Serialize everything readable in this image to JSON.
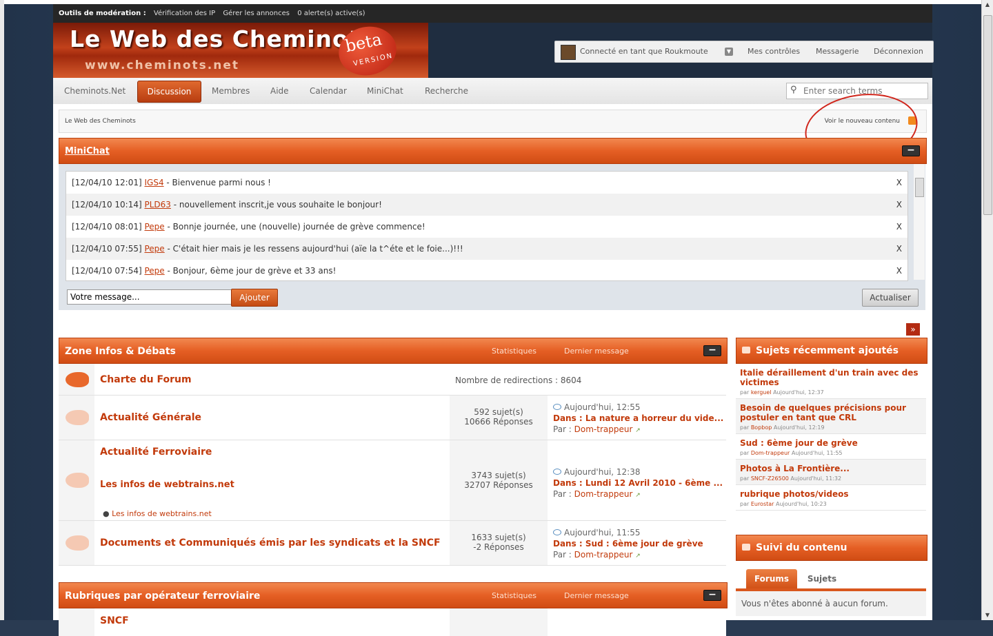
{
  "modbar": {
    "label": "Outils de modération :",
    "links": [
      "Vérification des IP",
      "Gérer les annonces",
      "0 alerte(s) active(s)"
    ]
  },
  "logo": {
    "title": "Le Web des Cheminots",
    "url": "www.cheminots.net",
    "beta": "beta",
    "version": "VERSION"
  },
  "userbar": {
    "connected": "Connecté en tant que Roukmoute",
    "links": [
      "Mes contrôles",
      "Messagerie",
      "Déconnexion"
    ]
  },
  "nav": {
    "items": [
      "Cheminots.Net",
      "Discussion",
      "Membres",
      "Aide",
      "Calendar",
      "MiniChat",
      "Recherche"
    ],
    "active": "Discussion",
    "search_placeholder": "Enter search terms"
  },
  "breadcrumb": {
    "home": "Le Web des Cheminots",
    "new_content": "Voir le nouveau contenu"
  },
  "minichat": {
    "title": "MiniChat",
    "messages": [
      {
        "time": "[12/04/10 12:01]",
        "user": "IGS4",
        "text": " - Bienvenue parmi nous !"
      },
      {
        "time": "[12/04/10 10:14]",
        "user": "PLD63",
        "text": " - nouvellement inscrit,je vous souhaite le bonjour!"
      },
      {
        "time": "[12/04/10 08:01]",
        "user": "Pepe",
        "text": " - Bonnje journée, une (nouvelle) journée de grève commence!"
      },
      {
        "time": "[12/04/10 07:55]",
        "user": "Pepe",
        "text": " - C'était hier mais je les ressens aujourd'hui (aïe la t^éte et le foie...)!!!"
      },
      {
        "time": "[12/04/10 07:54]",
        "user": "Pepe",
        "text": " - Bonjour, 6ème jour de grève et 33 ans!"
      }
    ],
    "delete": "X",
    "input_value": "Votre message...",
    "add_button": "Ajouter",
    "refresh_button": "Actualiser"
  },
  "categories": [
    {
      "title": "Zone Infos & Débats",
      "stats": "Statistiques",
      "last": "Dernier message"
    },
    {
      "title": "Rubriques par opérateur ferroviaire",
      "stats": "Statistiques",
      "last": "Dernier message"
    }
  ],
  "forums": {
    "charte": {
      "name": "Charte du Forum",
      "redirects": "Nombre de redirections : 8604"
    },
    "actu": {
      "name": "Actualité Générale",
      "topics": "592 sujet(s)",
      "replies": "10666 Réponses",
      "when": "Aujourd'hui, 12:55",
      "in": "Dans : ",
      "topic": "La nature a horreur du vide...",
      "by_label": "Par : ",
      "by": "Dom-trappeur"
    },
    "ferro": {
      "name": "Actualité Ferroviaire",
      "subname": "Les infos de webtrains.net",
      "sublink": "Les infos de webtrains.net",
      "topics": "3743 sujet(s)",
      "replies": "32707 Réponses",
      "when": "Aujourd'hui, 12:38",
      "in": "Dans : ",
      "topic": "Lundi 12 Avril 2010 - 6ème ...",
      "by_label": "Par : ",
      "by": "Dom-trappeur"
    },
    "docs": {
      "name": "Documents et Communiqués émis par les syndicats et la SNCF",
      "topics": "1633 sujet(s)",
      "replies": "-2 Réponses",
      "when": "Aujourd'hui, 11:55",
      "in": "Dans : ",
      "topic": "Sud : 6ème jour de grève",
      "by_label": "Par : ",
      "by": "Dom-trappeur"
    },
    "sncf": {
      "name": "SNCF"
    }
  },
  "recent": {
    "title": "Sujets récemment ajoutés",
    "items": [
      {
        "title": "Italie déraillement d'un train avec des victimes",
        "by": "par ",
        "user": "kerguel",
        "when": " Aujourd'hui, 12:37"
      },
      {
        "title": "Besoin de quelques précisions pour postuler en tant que CRL",
        "by": "par ",
        "user": "Bopbop",
        "when": " Aujourd'hui, 12:19"
      },
      {
        "title": "Sud : 6ème jour de grève",
        "by": "par ",
        "user": "Dom-trappeur",
        "when": " Aujourd'hui, 11:55"
      },
      {
        "title": "Photos à La Frontière...",
        "by": "par ",
        "user": "SNCF-Z26500",
        "when": " Aujourd'hui, 11:32"
      },
      {
        "title": "rubrique photos/videos",
        "by": "par ",
        "user": "Eurostar",
        "when": " Aujourd'hui, 10:23"
      }
    ]
  },
  "follow": {
    "title": "Suivi du contenu",
    "tab_forums": "Forums",
    "tab_topics": "Sujets",
    "message": "Vous n'êtes abonné à aucun forum."
  }
}
